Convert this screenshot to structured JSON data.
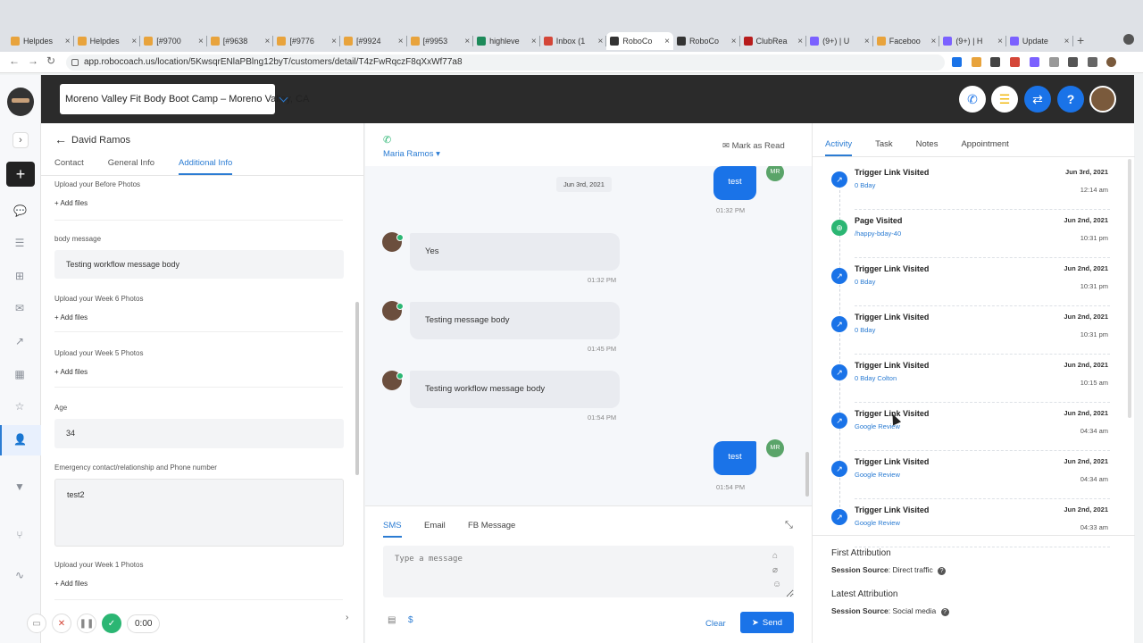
{
  "browser": {
    "tabs": [
      {
        "label": "Helpdes",
        "color": "#e8a33c"
      },
      {
        "label": "Helpdes",
        "color": "#e8a33c"
      },
      {
        "label": "[#9700",
        "color": "#e8a33c"
      },
      {
        "label": "[#9638",
        "color": "#e8a33c"
      },
      {
        "label": "[#9776",
        "color": "#e8a33c"
      },
      {
        "label": "[#9924",
        "color": "#e8a33c"
      },
      {
        "label": "[#9953",
        "color": "#e8a33c"
      },
      {
        "label": "highleve",
        "color": "#1d8a5a"
      },
      {
        "label": "Inbox (1",
        "color": "#d44638"
      },
      {
        "label": "RoboCo",
        "color": "#333333"
      },
      {
        "label": "RoboCo",
        "color": "#333333"
      },
      {
        "label": "ClubRea",
        "color": "#b71c1c"
      },
      {
        "label": "(9+) | U",
        "color": "#7b61ff"
      },
      {
        "label": "Faceboo",
        "color": "#e8a33c"
      },
      {
        "label": "(9+) | H",
        "color": "#7b61ff"
      },
      {
        "label": "Update",
        "color": "#7b61ff"
      }
    ],
    "active_tab_index": 9,
    "url": "app.robocoach.us/location/5KwsqrENlaPBlng12byT/customers/detail/T4zFwRqczF8qXxWf77a8"
  },
  "header": {
    "location": "Moreno Valley Fit Body Boot Camp – Moreno Valley, CA",
    "help_label": "?"
  },
  "contact": {
    "name": "David Ramos",
    "tabs": [
      "Contact",
      "General Info",
      "Additional Info"
    ],
    "active_tab": "Additional Info",
    "fields": {
      "before_photos_label": "Upload your Before Photos",
      "add_files": "+ Add files",
      "body_message_label": "body message",
      "body_message_value": "Testing workflow message body",
      "week6_label": "Upload your Week 6 Photos",
      "week5_label": "Upload your Week 5 Photos",
      "age_label": "Age",
      "age_value": "34",
      "emergency_label": "Emergency contact/relationship and Phone number",
      "emergency_value": "test2",
      "week1_label": "Upload your Week 1 Photos"
    }
  },
  "recorder": {
    "time": "0:00"
  },
  "conversation": {
    "contact_name": "Maria Ramos",
    "mark_as_read": "Mark as Read",
    "date_separator": "Jun 3rd, 2021",
    "messages": [
      {
        "dir": "out",
        "text": "test",
        "time": "01:32 PM",
        "avatar": "MR"
      },
      {
        "dir": "in",
        "text": "Yes",
        "time": "01:32 PM"
      },
      {
        "dir": "in",
        "text": "Testing message body",
        "time": "01:45 PM"
      },
      {
        "dir": "in",
        "text": "Testing workflow message body",
        "time": "01:54 PM"
      },
      {
        "dir": "out",
        "text": "test",
        "time": "01:54 PM",
        "avatar": "MR"
      }
    ],
    "composer": {
      "tabs": [
        "SMS",
        "Email",
        "FB Message"
      ],
      "active_tab": "SMS",
      "placeholder": "Type a message",
      "clear_label": "Clear",
      "send_label": "Send"
    }
  },
  "activity": {
    "tabs": [
      "Activity",
      "Task",
      "Notes",
      "Appointment"
    ],
    "active_tab": "Activity",
    "items": [
      {
        "title": "Trigger Link Visited",
        "link": "0 Bday",
        "date": "Jun 3rd, 2021",
        "time": "12:14 am",
        "icon": "external-link-icon"
      },
      {
        "title": "Page Visited",
        "link": "/happy-bday-40",
        "date": "Jun 2nd, 2021",
        "time": "10:31 pm",
        "icon": "globe-icon"
      },
      {
        "title": "Trigger Link Visited",
        "link": "0 Bday",
        "date": "Jun 2nd, 2021",
        "time": "10:31 pm",
        "icon": "external-link-icon"
      },
      {
        "title": "Trigger Link Visited",
        "link": "0 Bday",
        "date": "Jun 2nd, 2021",
        "time": "10:31 pm",
        "icon": "external-link-icon"
      },
      {
        "title": "Trigger Link Visited",
        "link": "0 Bday Colton",
        "date": "Jun 2nd, 2021",
        "time": "10:15 am",
        "icon": "external-link-icon"
      },
      {
        "title": "Trigger Link Visited",
        "link": "Google Review",
        "date": "Jun 2nd, 2021",
        "time": "04:34 am",
        "icon": "external-link-icon"
      },
      {
        "title": "Trigger Link Visited",
        "link": "Google Review",
        "date": "Jun 2nd, 2021",
        "time": "04:34 am",
        "icon": "external-link-icon"
      },
      {
        "title": "Trigger Link Visited",
        "link": "Google Review",
        "date": "Jun 2nd, 2021",
        "time": "04:33 am",
        "icon": "external-link-icon"
      }
    ],
    "first_attribution": {
      "heading": "First Attribution",
      "label": "Session Source",
      "value": ": Direct traffic"
    },
    "latest_attribution": {
      "heading": "Latest Attribution",
      "label": "Session Source",
      "value": ": Social media"
    }
  }
}
